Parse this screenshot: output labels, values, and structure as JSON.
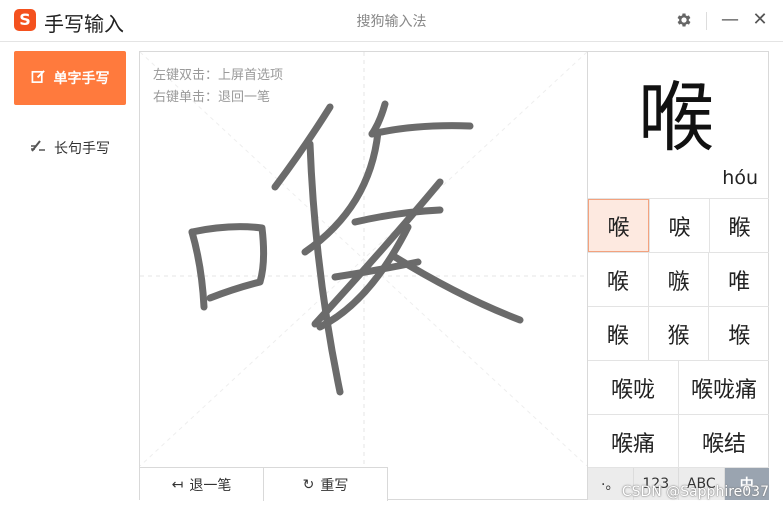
{
  "titlebar": {
    "logo_glyph": "S",
    "app_title": "手写输入",
    "window_title": "搜狗输入法",
    "settings_icon": "gear-icon",
    "minimize_glyph": "—",
    "close_glyph": "✕"
  },
  "sidebar": {
    "items": [
      {
        "label": "单字手写",
        "icon": "edit-square-icon",
        "active": true
      },
      {
        "label": "长句手写",
        "icon": "pen-lines-icon",
        "active": false
      }
    ]
  },
  "canvas": {
    "hint_line1": "左键双击：上屏首选项",
    "hint_line2": "右键单击：退回一笔",
    "undo_label": "退一笔",
    "undo_icon": "arrow-left-icon",
    "rewrite_label": "重写",
    "rewrite_icon": "refresh-icon"
  },
  "candidates": {
    "preview_char": "喉",
    "preview_pinyin": "hóu",
    "rows": [
      [
        "喉",
        "唳",
        "睺"
      ],
      [
        "喉",
        "嗾",
        "唯"
      ],
      [
        "睺",
        "猴",
        "堠"
      ],
      [
        "喉咙",
        "喉咙痛"
      ],
      [
        "喉痛",
        "喉结"
      ]
    ],
    "selected": "0-0",
    "modes": [
      {
        "label": "·。",
        "active": false
      },
      {
        "label": "123",
        "active": false
      },
      {
        "label": "ABC",
        "active": false
      },
      {
        "label": "中",
        "active": true
      }
    ]
  },
  "watermark": "CSDN @Sapphire037",
  "colors": {
    "accent": "#ff7a3d",
    "logo": "#f4511e",
    "stroke": "#6b6b6b",
    "selected_bg": "#fde9e0",
    "mode_active": "#9aa4b0"
  }
}
